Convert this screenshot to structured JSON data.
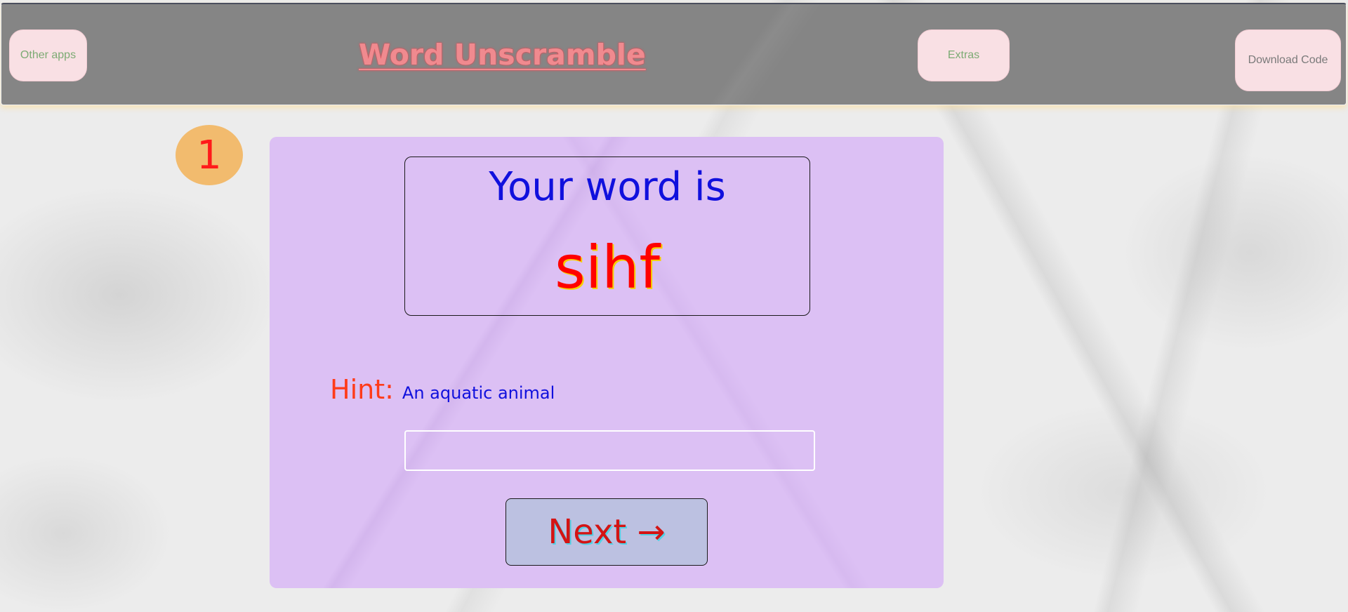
{
  "header": {
    "title": "Word Unscramble",
    "other_apps_label": "Other apps",
    "extras_label": "Extras",
    "download_label": "Download Code"
  },
  "game": {
    "question_number": "1",
    "word_label": "Your word is",
    "scrambled_word": "sihf",
    "hint_label": "Hint:",
    "hint_text": "An aquatic animal",
    "answer_value": "",
    "next_label": "Next →"
  },
  "colors": {
    "header_bg": "#858585",
    "button_bg": "#f9e0e4",
    "card_bg": "#dcc0f4",
    "counter_bg": "#f2bb6e",
    "word_label": "#1010dd",
    "scrambled_word": "#ff0000",
    "hint_label": "#ff3b1a",
    "next_button_bg": "#bcc1e1"
  }
}
